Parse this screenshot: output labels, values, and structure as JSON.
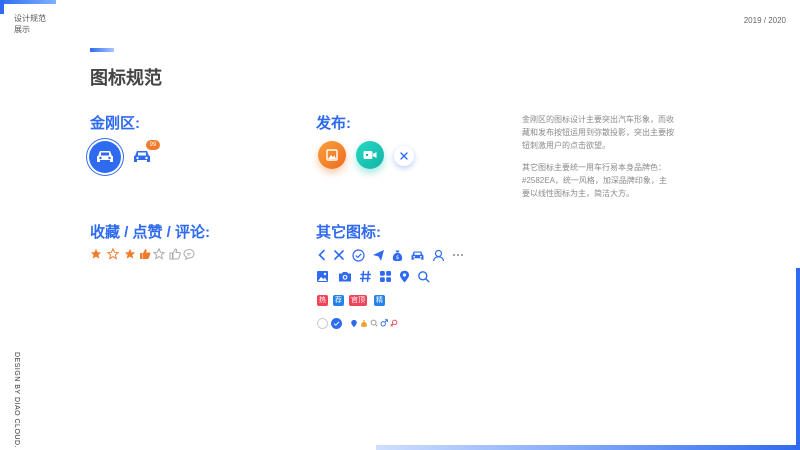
{
  "header": {
    "left_line1": "设计规范",
    "left_line2": "展示",
    "right": "2019 / 2020"
  },
  "sidebar_text": "DESIGN BY DIAO CLOUD.",
  "page_title": "图标规范",
  "sections": {
    "jingang": "金刚区:",
    "publish": "发布:",
    "collect": "收藏 / 点赞 / 评论:",
    "other": "其它图标:"
  },
  "badge_count": "99",
  "description": {
    "para1": "金刚区的图标设计主要突出汽车形象，而收藏和发布按钮运用到弥散投影，突出主要按钮刺激用户的点击欲望。",
    "para2": "其它图标主要统一用车行易本身品牌色：#2582EA，统一风格，加深品牌印象，主要以线性图标为主，简洁大方。"
  },
  "tags": {
    "hot": "热",
    "recommend": "荐",
    "official": "官顶",
    "featured": "精"
  },
  "colors": {
    "brand": "#2582EA",
    "accent": "#2f6bf0",
    "orange": "#f07b2a",
    "teal": "#1bc6b4",
    "red": "#f0445a"
  },
  "icons": [
    "car-icon",
    "star-icon",
    "thumb-up-icon",
    "comment-icon",
    "chevron-left-icon",
    "close-icon",
    "check-circle-icon",
    "send-icon",
    "money-bag-icon",
    "user-icon",
    "more-icon",
    "image-icon",
    "camera-icon",
    "hashtag-icon",
    "grid-icon",
    "location-icon",
    "search-icon",
    "male-icon",
    "female-icon"
  ]
}
